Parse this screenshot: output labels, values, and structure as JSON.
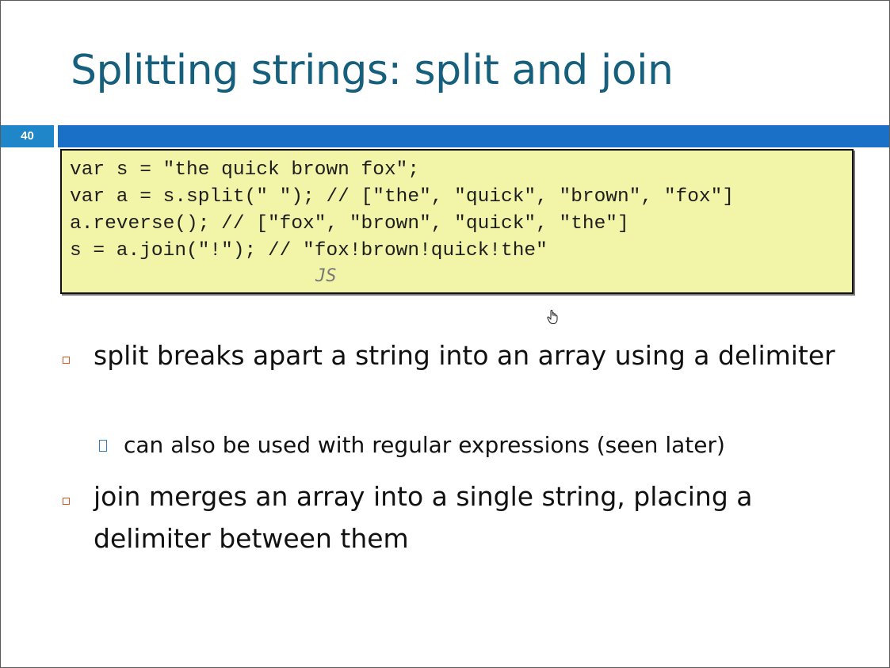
{
  "slide": {
    "title": "Splitting strings: split and join",
    "number": "40"
  },
  "code": {
    "lines": [
      "var s = \"the quick brown fox\";",
      "var a = s.split(\" \"); // [\"the\", \"quick\", \"brown\", \"fox\"]",
      "a.reverse(); // [\"fox\", \"brown\", \"quick\", \"the\"]",
      "s = a.join(\"!\"); // \"fox!brown!quick!the\""
    ],
    "language_label": "JS"
  },
  "bullets": [
    {
      "text": "split breaks apart a string into an array using a delimiter",
      "sub": "can also be used with regular expressions (seen later)"
    },
    {
      "text": "join merges an array into a single string, placing a delimiter between them"
    }
  ],
  "colors": {
    "title": "#17607d",
    "accent_bar": "#1a6fc6",
    "number_badge": "#1e86c9",
    "code_background": "#f2f5a8",
    "bullet_marker": "#d05a28"
  },
  "icons": {
    "cursor": "hand-pointer-icon",
    "bullet": "square-bullet-icon",
    "sub_bullet": "box-glyph-icon"
  }
}
